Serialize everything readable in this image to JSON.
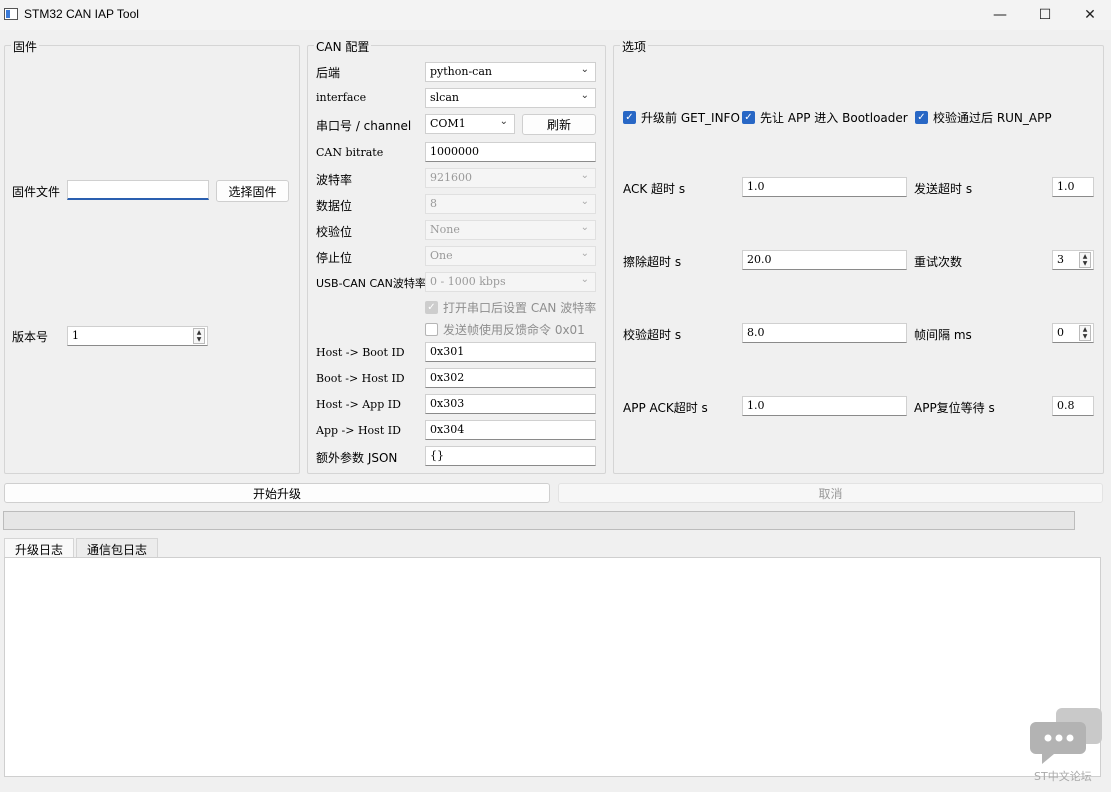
{
  "window": {
    "title": "STM32 CAN IAP Tool",
    "minimize_glyph": "—",
    "maximize_glyph": "☐",
    "close_glyph": "✕"
  },
  "firmware": {
    "group_title": "固件",
    "file_label": "固件文件",
    "file_value": "",
    "choose_button": "选择固件",
    "version_label": "版本号",
    "version_value": "1"
  },
  "can": {
    "group_title": "CAN 配置",
    "backend_label": "后端",
    "backend_value": "python-can",
    "interface_label": "interface",
    "interface_value": "slcan",
    "port_label": "串口号 / channel",
    "port_value": "COM1",
    "refresh_button": "刷新",
    "bitrate_label": "CAN bitrate",
    "bitrate_value": "1000000",
    "baud_label": "波特率",
    "baud_value": "921600",
    "databits_label": "数据位",
    "databits_value": "8",
    "parity_label": "校验位",
    "parity_value": "None",
    "stopbits_label": "停止位",
    "stopbits_value": "One",
    "usbcan_label": "USB-CAN CAN波特率",
    "usbcan_value": "0 - 1000 kbps",
    "set_can_baud_label": "打开串口后设置 CAN 波特率",
    "feedback_label": "发送帧使用反馈命令 0x01",
    "host_boot_label": "Host -> Boot ID",
    "host_boot_value": "0x301",
    "boot_host_label": "Boot -> Host ID",
    "boot_host_value": "0x302",
    "host_app_label": "Host -> App ID",
    "host_app_value": "0x303",
    "app_host_label": "App -> Host ID",
    "app_host_value": "0x304",
    "extra_label": "额外参数 JSON",
    "extra_value": "{}"
  },
  "options": {
    "group_title": "选项",
    "get_info_label": "升级前 GET_INFO",
    "bootloader_label": "先让 APP 进入 Bootloader",
    "run_app_label": "校验通过后 RUN_APP",
    "ack_timeout_label": "ACK 超时 s",
    "ack_timeout_value": "1.0",
    "send_timeout_label": "发送超时 s",
    "send_timeout_value": "1.0",
    "erase_timeout_label": "擦除超时 s",
    "erase_timeout_value": "20.0",
    "retry_label": "重试次数",
    "retry_value": "3",
    "verify_timeout_label": "校验超时 s",
    "verify_timeout_value": "8.0",
    "frame_gap_label": "帧间隔 ms",
    "frame_gap_value": "0",
    "app_ack_label": "APP ACK超时 s",
    "app_ack_value": "1.0",
    "app_reset_label": "APP复位等待 s",
    "app_reset_value": "0.8"
  },
  "actions": {
    "start_button": "开始升级",
    "cancel_button": "取消"
  },
  "progress": {
    "value": 0
  },
  "tabs": [
    {
      "label": "升级日志"
    },
    {
      "label": "通信包日志"
    }
  ],
  "watermark": {
    "text": "ST中文论坛"
  },
  "icons": {
    "checkmark": "✓",
    "chevron": "⌄",
    "spin_up": "▲",
    "spin_down": "▼"
  }
}
